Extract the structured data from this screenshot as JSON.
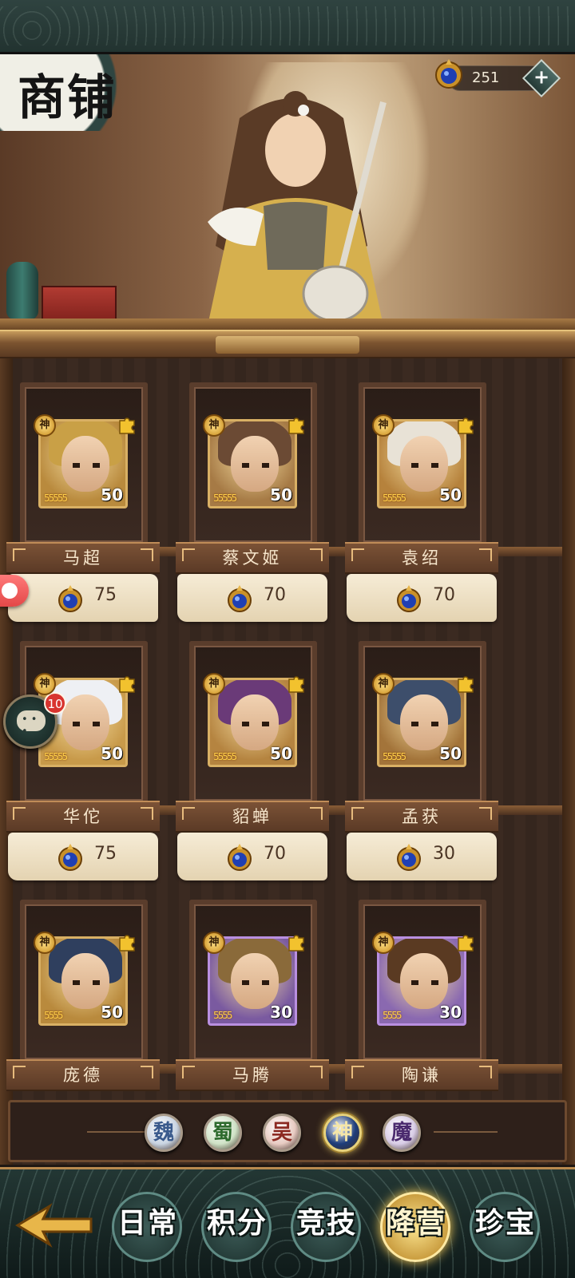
{
  "header": {
    "title": "商铺",
    "currency_amount": "251",
    "add_label": "+"
  },
  "colors": {
    "gold": "#d9b064",
    "wood_dark": "#3b2a21",
    "jade": "#2f4340",
    "active_glow": "#f5d868"
  },
  "heroes": [
    {
      "name": "马超",
      "badge": "神",
      "level": "50",
      "stars": "55555",
      "price": "75",
      "hair": "#c9a046",
      "bg": "#b98a3d"
    },
    {
      "name": "蔡文姬",
      "badge": "神",
      "level": "50",
      "stars": "55555",
      "price": "70",
      "hair": "#6b4a34",
      "bg": "#a67a45"
    },
    {
      "name": "袁绍",
      "badge": "神",
      "level": "50",
      "stars": "55555",
      "price": "70",
      "hair": "#e8e2d6",
      "bg": "#b6823c"
    },
    {
      "name": "华佗",
      "badge": "神",
      "level": "50",
      "stars": "55555",
      "price": "75",
      "hair": "#eef0f4",
      "bg": "#c89a4a"
    },
    {
      "name": "貂蝉",
      "badge": "神",
      "level": "50",
      "stars": "55555",
      "price": "70",
      "hair": "#6a3a78",
      "bg": "#b58440"
    },
    {
      "name": "孟获",
      "badge": "神",
      "level": "50",
      "stars": "55555",
      "price": "30",
      "hair": "#3d4e6b",
      "bg": "#a3743a"
    },
    {
      "name": "庞德",
      "badge": "神",
      "level": "50",
      "stars": "5555",
      "price": "",
      "hair": "#2f3f5e",
      "bg": "#b98a3d"
    },
    {
      "name": "马腾",
      "badge": "神",
      "level": "30",
      "stars": "5555",
      "price": "",
      "hair": "#8a6a3a",
      "bg": "#7a5aa0"
    },
    {
      "name": "陶谦",
      "badge": "神",
      "level": "30",
      "stars": "5555",
      "price": "",
      "hair": "#5a3a22",
      "bg": "#8a69b0"
    }
  ],
  "factions": [
    {
      "label": "魏",
      "color": "#3a5a8c",
      "bg": "#c9d4e2"
    },
    {
      "label": "蜀",
      "color": "#2e6b2e",
      "bg": "#cfe2c6"
    },
    {
      "label": "吴",
      "color": "#8c2a22",
      "bg": "#e8cbc2"
    },
    {
      "label": "神",
      "color": "#f5e6a8",
      "bg": "#1e3d7a"
    },
    {
      "label": "魔",
      "color": "#4a2a6e",
      "bg": "#d8cce6"
    }
  ],
  "nav": {
    "tabs": [
      {
        "label": "日常"
      },
      {
        "label": "积分"
      },
      {
        "label": "竞技"
      },
      {
        "label": "降营"
      },
      {
        "label": "珍宝"
      }
    ]
  },
  "chat": {
    "unread": "10"
  }
}
